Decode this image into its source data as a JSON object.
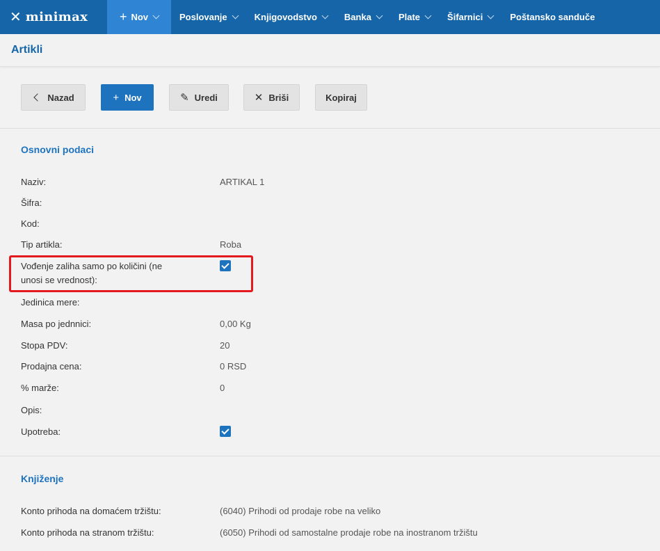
{
  "nav": {
    "logo_mark": "✕",
    "logo_name": "minimax",
    "new_label": "Nov",
    "items": [
      "Poslovanje",
      "Knjigovodstvo",
      "Banka",
      "Plate",
      "Šifarnici",
      "Poštansko sanduče"
    ]
  },
  "page": {
    "title": "Artikli"
  },
  "toolbar": {
    "back_label": "Nazad",
    "new_label": "Nov",
    "edit_label": "Uredi",
    "delete_label": "Briši",
    "copy_label": "Kopiraj"
  },
  "basic": {
    "title": "Osnovni podaci",
    "naziv_label": "Naziv:",
    "naziv_value": "ARTIKAL 1",
    "sifra_label": "Šifra:",
    "kod_label": "Kod:",
    "tip_label": "Tip artikla:",
    "tip_value": "Roba",
    "vodjenje_label_1": "Vođenje zaliha samo po količini (ne",
    "vodjenje_label_2": "unosi se vrednost):",
    "vodjenje_checked": true,
    "jedinica_label": "Jedinica mere:",
    "masa_label": "Masa po jednnici:",
    "masa_value": "0,00 Kg",
    "stopa_label": "Stopa PDV:",
    "stopa_value": "20",
    "cena_label": "Prodajna cena:",
    "cena_value": "0 RSD",
    "marza_label": "% marže:",
    "marza_value": "0",
    "opis_label": "Opis:",
    "upotreba_label": "Upotreba:",
    "upotreba_checked": true
  },
  "posting": {
    "title": "Knjiženje",
    "domestic_label": "Konto prihoda na domaćem tržištu:",
    "domestic_value": "(6040) Prihodi od prodaje robe na veliko",
    "foreign_label": "Konto prihoda na stranom tržištu:",
    "foreign_value": "(6050) Prihodi od samostalne prodaje robe na inostranom tržištu"
  },
  "colors": {
    "brand": "#1565a8",
    "accent": "#1e73be",
    "highlight": "#e3191e"
  }
}
